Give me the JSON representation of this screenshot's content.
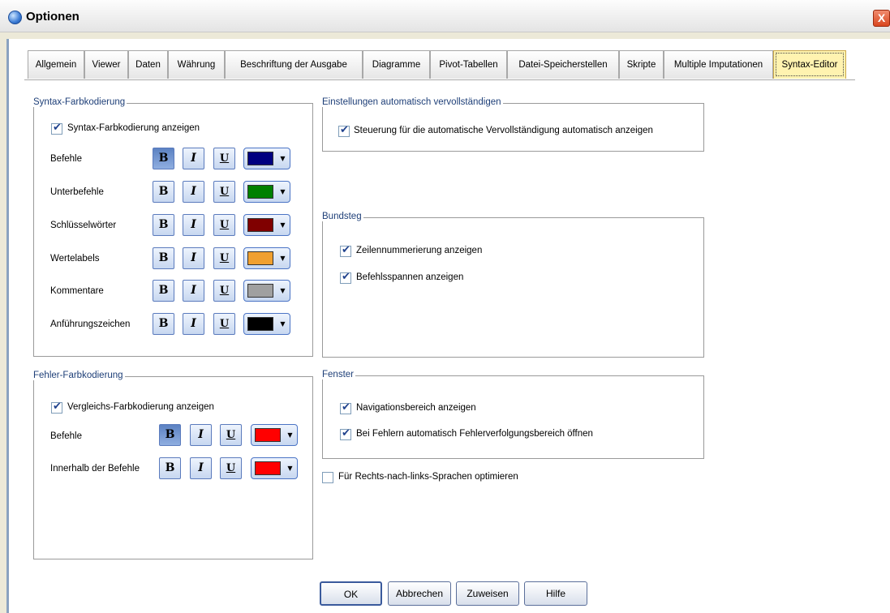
{
  "window": {
    "title": "Optionen",
    "close_glyph": "X"
  },
  "tabs": [
    {
      "label": "Allgemein"
    },
    {
      "label": "Viewer"
    },
    {
      "label": "Daten"
    },
    {
      "label": "Währung"
    },
    {
      "label": "Beschriftung der Ausgabe"
    },
    {
      "label": "Diagramme"
    },
    {
      "label": "Pivot-Tabellen"
    },
    {
      "label": "Datei-Speicherstellen"
    },
    {
      "label": "Skripte"
    },
    {
      "label": "Multiple Imputationen"
    },
    {
      "label": "Syntax-Editor",
      "active": true
    }
  ],
  "syntax_coloring": {
    "legend": "Syntax-Farbkodierung",
    "show_label": "Syntax-Farbkodierung anzeigen",
    "show_checked": true,
    "rows": [
      {
        "label": "Befehle",
        "bold": true,
        "color": "#000080"
      },
      {
        "label": "Unterbefehle",
        "bold": false,
        "color": "#008000"
      },
      {
        "label": "Schlüsselwörter",
        "bold": false,
        "color": "#800000"
      },
      {
        "label": "Wertelabels",
        "bold": false,
        "color": "#f0a030"
      },
      {
        "label": "Kommentare",
        "bold": false,
        "color": "#a0a0a0"
      },
      {
        "label": "Anführungszeichen",
        "bold": false,
        "color": "#000000"
      }
    ]
  },
  "error_coloring": {
    "legend": "Fehler-Farbkodierung",
    "show_label": "Vergleichs-Farbkodierung anzeigen",
    "show_checked": true,
    "rows": [
      {
        "label": "Befehle",
        "bold": true,
        "color": "#ff0000"
      },
      {
        "label": "Innerhalb der Befehle",
        "bold": false,
        "color": "#ff0000"
      }
    ]
  },
  "autocomplete": {
    "legend": "Einstellungen automatisch vervollständigen",
    "option_label": "Steuerung für die automatische Vervollständigung automatisch anzeigen",
    "checked": true
  },
  "gutter": {
    "legend": "Bundsteg",
    "line_numbers_label": "Zeilennummerierung anzeigen",
    "line_numbers_checked": true,
    "spans_label": "Befehlsspannen anzeigen",
    "spans_checked": true
  },
  "window_panes": {
    "legend": "Fenster",
    "nav_label": "Navigationsbereich anzeigen",
    "nav_checked": true,
    "error_label": "Bei Fehlern automatisch Fehlerverfolgungsbereich öffnen",
    "error_checked": true
  },
  "rtl": {
    "label": "Für Rechts-nach-links-Sprachen optimieren",
    "checked": false
  },
  "format_glyphs": {
    "bold": "B",
    "italic": "I",
    "underline": "U",
    "dropdown": "▼"
  },
  "buttons": {
    "ok": "OK",
    "cancel": "Abbrechen",
    "apply": "Zuweisen",
    "help": "Hilfe"
  }
}
